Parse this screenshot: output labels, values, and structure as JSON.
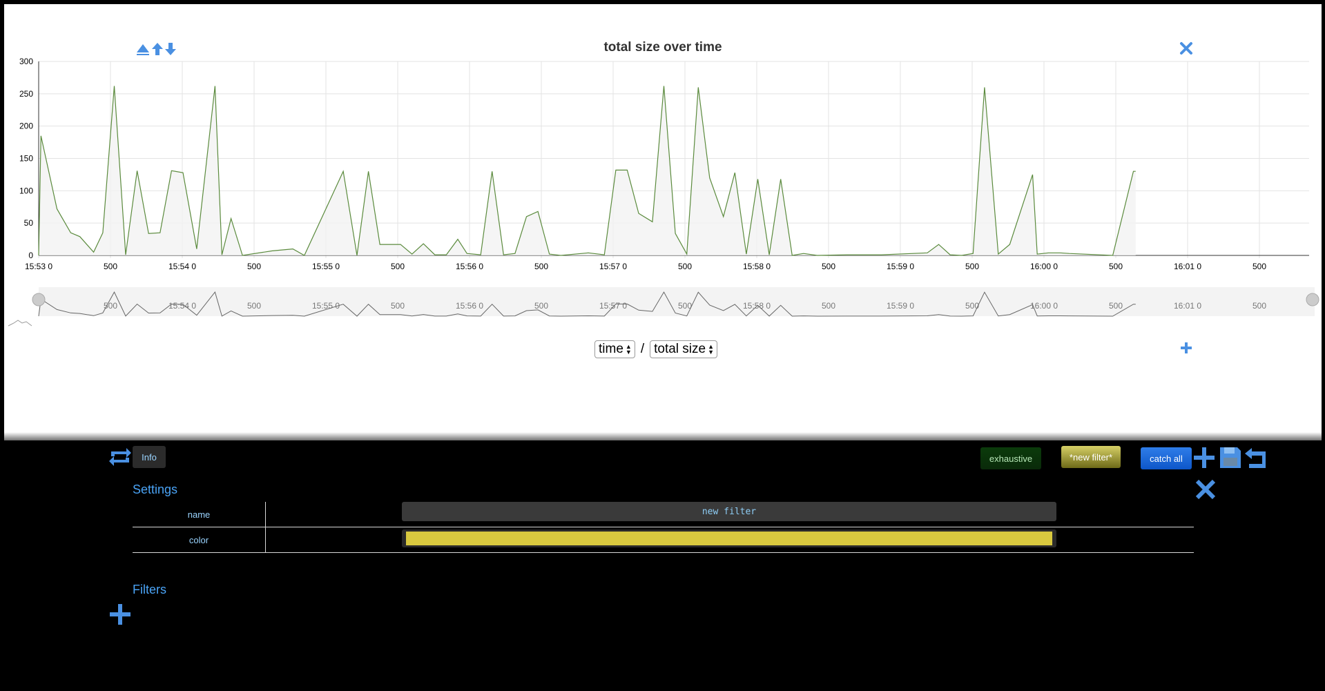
{
  "chart_data": {
    "type": "area",
    "title": "total size over time",
    "xlabel": "",
    "ylabel": "",
    "y_ticks": [
      "300",
      "250",
      "200",
      "150",
      "100",
      "50",
      "0"
    ],
    "ylim": [
      0,
      300
    ],
    "x_ticks": [
      "15:53 0",
      "500",
      "15:54 0",
      "500",
      "15:55 0",
      "500",
      "15:56 0",
      "500",
      "15:57 0",
      "500",
      "15:58 0",
      "500",
      "15:59 0",
      "500",
      "16:00 0",
      "500",
      "16:01 0",
      "500"
    ],
    "overview_ticks": [
      "500",
      "15:54 0",
      "500",
      "15:55 0",
      "500",
      "15:56 0",
      "500",
      "15:57 0",
      "500",
      "15:58 0",
      "500",
      "15:59 0",
      "500",
      "16:00 0",
      "500",
      "16:01 0",
      "500"
    ],
    "x_unit": "seconds since 15:53",
    "xlim": [
      0,
      527
    ],
    "grid": true,
    "series": [
      {
        "color": "#5a8a3c",
        "x": [
          0,
          1,
          8,
          14,
          18,
          24,
          28,
          33,
          38,
          43,
          48,
          53,
          58,
          63,
          69,
          77,
          80,
          84,
          89,
          102,
          111,
          116,
          133,
          139,
          144,
          149,
          158,
          163,
          168,
          173,
          178,
          183,
          187,
          193,
          198,
          203,
          208,
          213,
          218,
          223,
          228,
          240,
          247,
          252,
          257,
          262,
          268,
          273,
          278,
          283,
          288,
          293,
          299,
          304,
          309,
          314,
          319,
          324,
          329,
          334,
          340,
          353,
          368,
          388,
          393,
          398,
          403,
          408,
          413,
          419,
          424,
          434,
          436,
          441,
          446,
          450,
          469,
          478,
          479
        ],
        "y": [
          0,
          185,
          72,
          35,
          29,
          5,
          35,
          262,
          1,
          131,
          34,
          35,
          131,
          128,
          10,
          262,
          1,
          57,
          0,
          7,
          10,
          0,
          130,
          0,
          130,
          17,
          17,
          2,
          18,
          1,
          1,
          25,
          3,
          1,
          130,
          1,
          3,
          60,
          68,
          2,
          0,
          4,
          1,
          132,
          132,
          65,
          52,
          262,
          34,
          2,
          260,
          120,
          60,
          128,
          2,
          118,
          1,
          118,
          0,
          3,
          0,
          1,
          1,
          4,
          17,
          1,
          0,
          3,
          260,
          2,
          17,
          125,
          2,
          4,
          4,
          3,
          0,
          130,
          130
        ]
      }
    ]
  },
  "axis_selectors": {
    "x_value": "time",
    "separator": "/",
    "y_value": "total size"
  },
  "icons": {
    "move": "move-arrows-icon",
    "close": "close-icon",
    "add_chart": "plus-icon",
    "refresh": "refresh-icon",
    "add": "plus-icon",
    "save": "save-icon",
    "undo": "undo-icon"
  },
  "toolbar": {
    "info_label": "Info",
    "exhaustive_label": "exhaustive",
    "new_filter_label": "*new filter*",
    "catch_all_label": "catch all"
  },
  "settings": {
    "title": "Settings",
    "name_label": "name",
    "name_value": "new filter",
    "color_label": "color",
    "color_value": "#d9c93f"
  },
  "filters": {
    "title": "Filters"
  },
  "colors": {
    "accent": "#4a90e2",
    "line": "#5a8a3c"
  }
}
